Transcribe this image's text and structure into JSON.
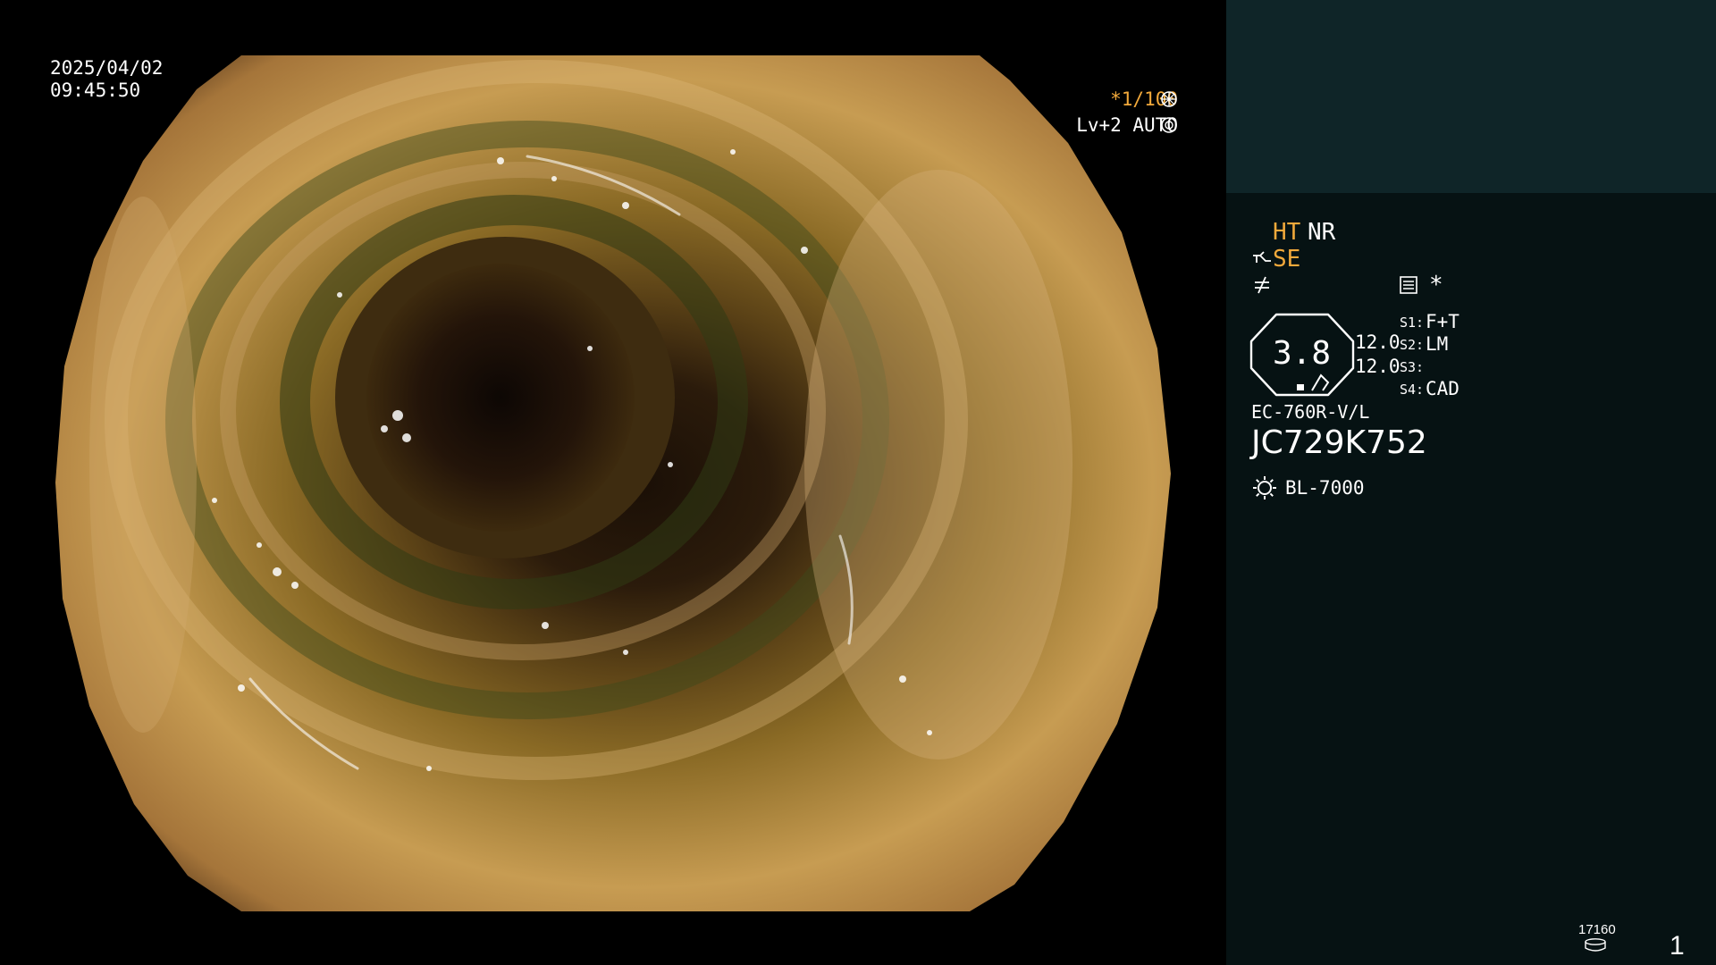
{
  "overlay": {
    "date": "2025/04/02",
    "time": "09:45:50",
    "shutter": "*1/100",
    "shutter_icon": "shutter-icon",
    "level": "Lv+2 AUTO",
    "level_icon": "iris-icon"
  },
  "panel": {
    "ht": "HT",
    "nr": "NR",
    "se": "SE",
    "star": "*",
    "gauge_value": "3.8",
    "value1": "12.0",
    "value2": "12.0",
    "s1_label": "S1:",
    "s1_value": "F+T",
    "s2_label": "S2:",
    "s2_value": "LM",
    "s3_label": "S3:",
    "s3_value": "",
    "s4_label": "S4:",
    "s4_value": "CAD",
    "scope_model": "EC-760R-V/L",
    "serial": "JC729K752",
    "light_source": "BL-7000",
    "image_count": "17160",
    "page": "1"
  },
  "colors": {
    "accent_orange": "#f2a93b",
    "panel_top": "#0f2528",
    "panel_bottom": "#061213"
  }
}
